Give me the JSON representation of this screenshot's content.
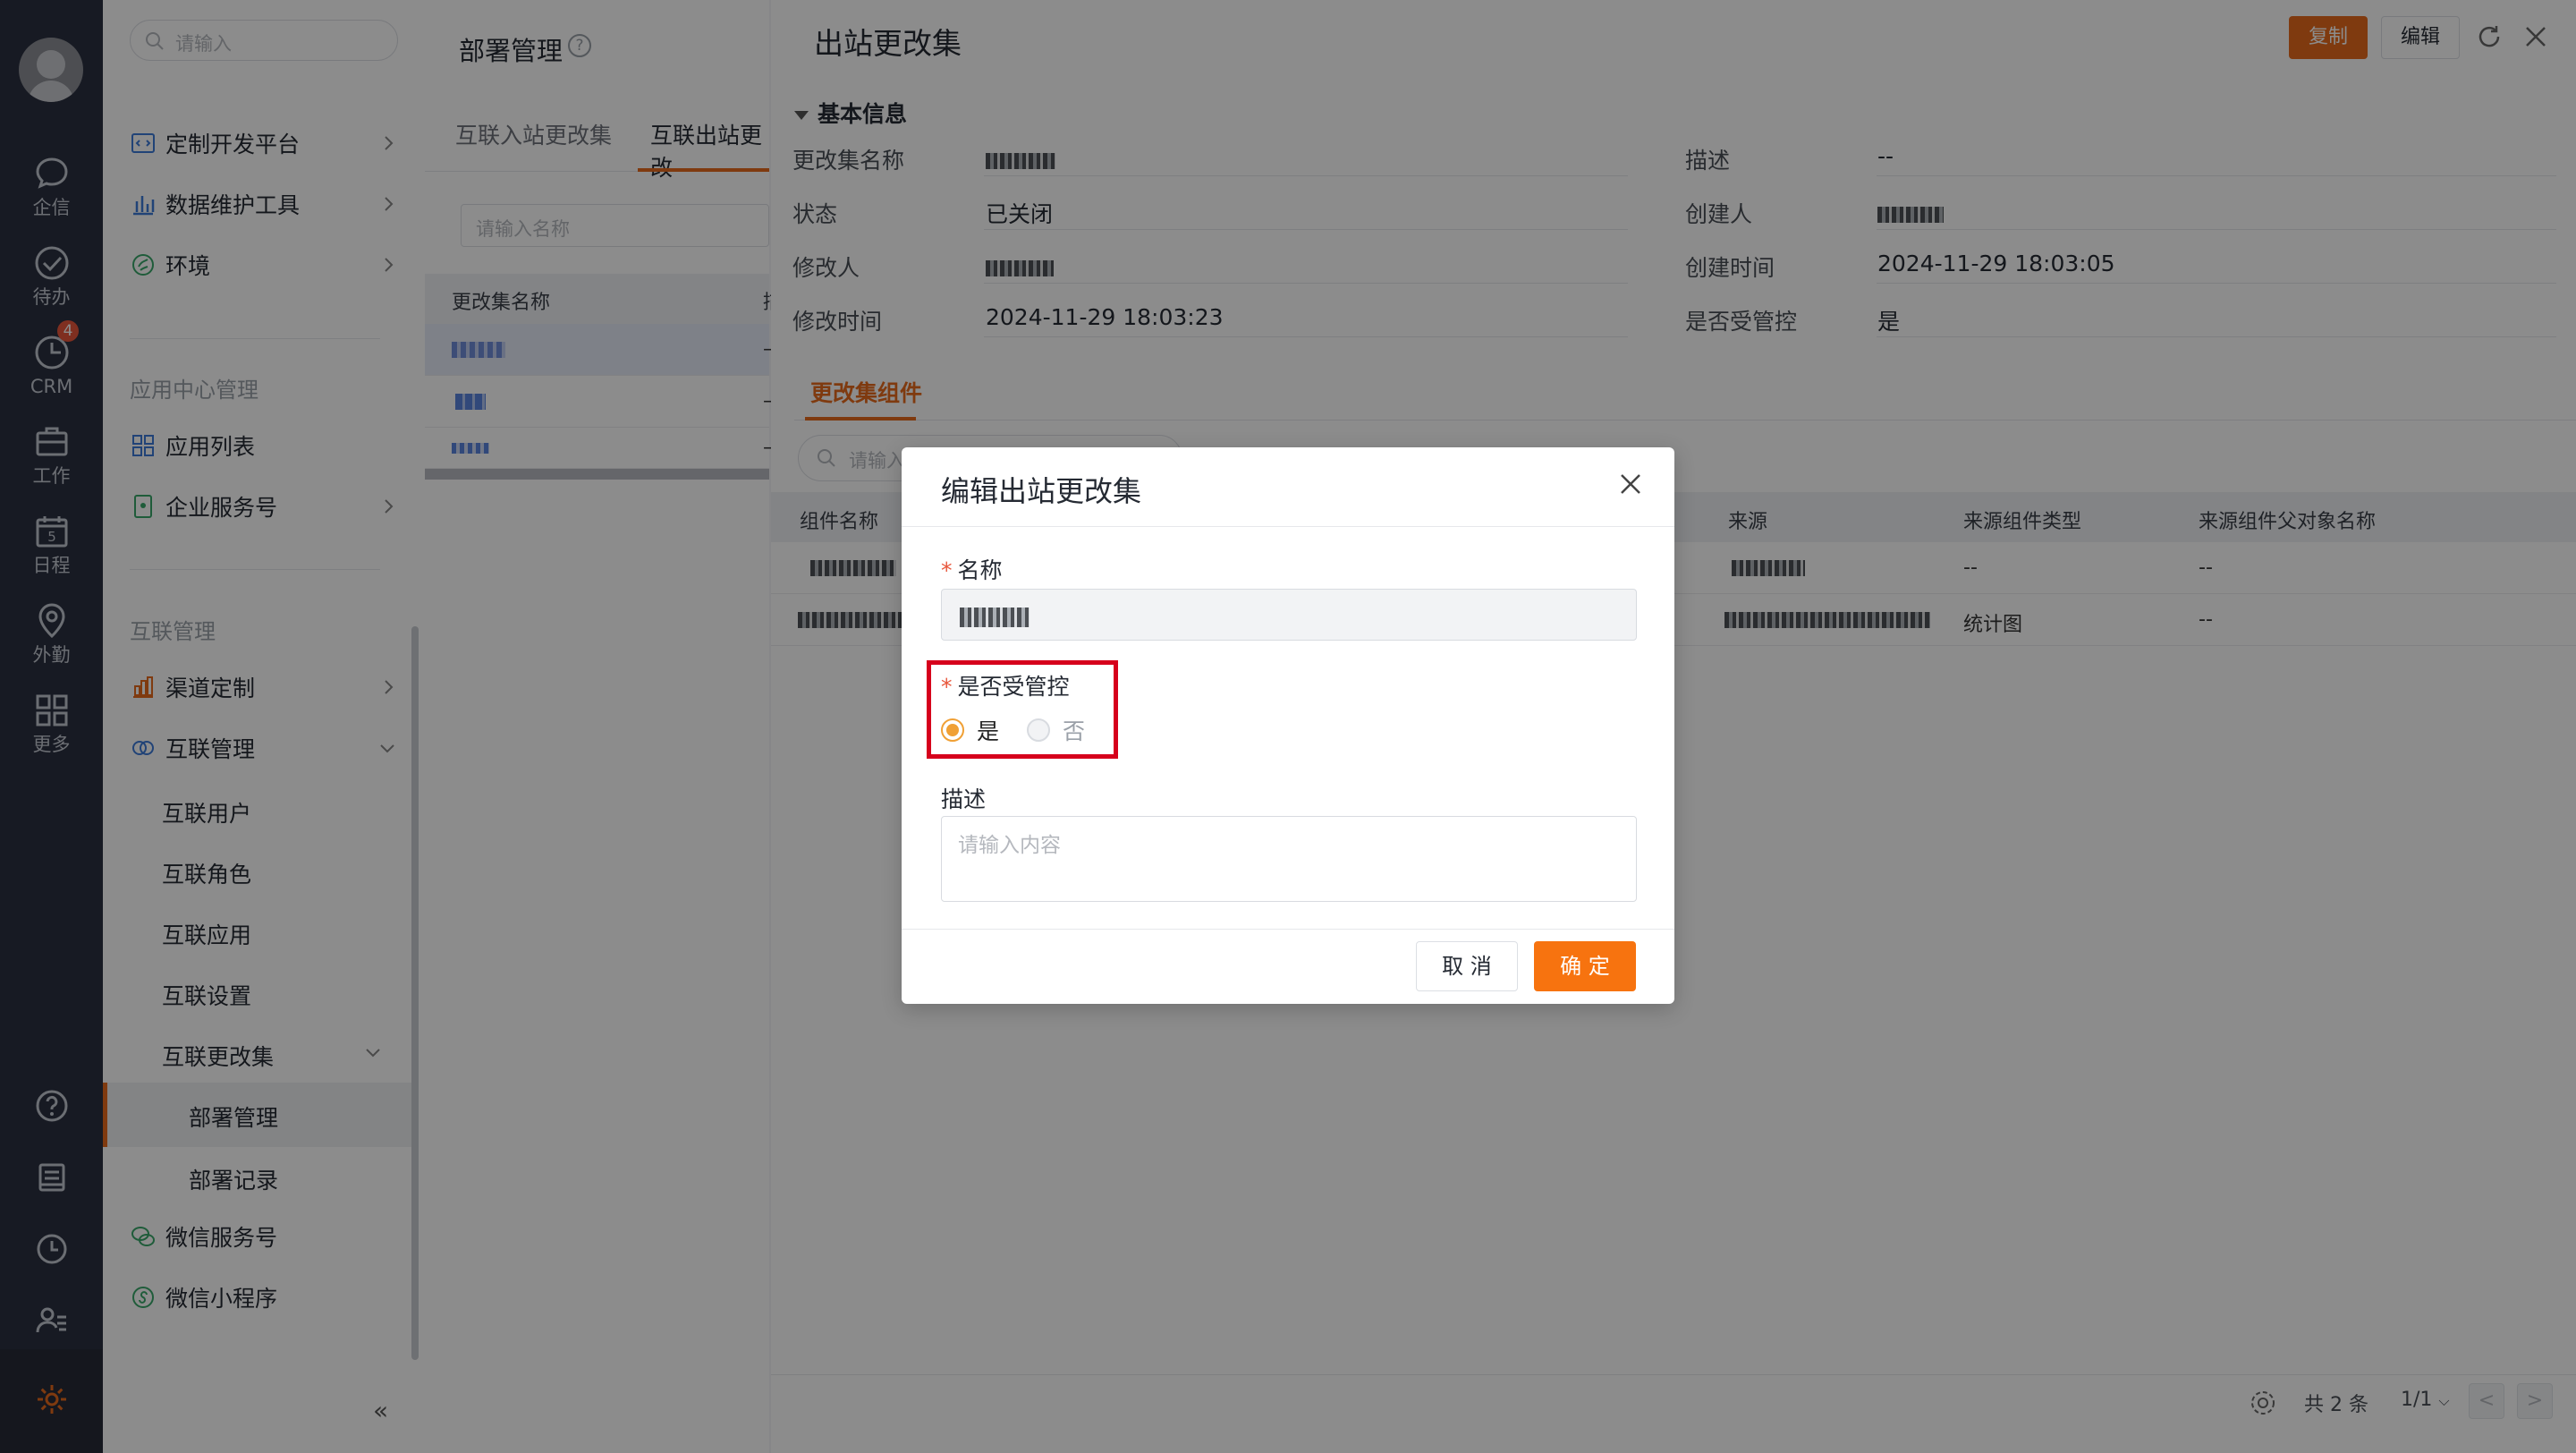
{
  "rail": {
    "items": [
      {
        "label": "企信",
        "icon": "chat-bubble-icon"
      },
      {
        "label": "待办",
        "icon": "check-circle-icon"
      },
      {
        "label": "CRM",
        "icon": "clock-pie-icon",
        "badge": "4"
      },
      {
        "label": "工作",
        "icon": "briefcase-icon"
      },
      {
        "label": "日程",
        "icon": "calendar-icon",
        "day": "5"
      },
      {
        "label": "外勤",
        "icon": "location-pin-icon"
      },
      {
        "label": "更多",
        "icon": "grid-icon"
      }
    ]
  },
  "sidebar": {
    "search_placeholder": "请输入",
    "items": [
      {
        "label": "定制开发平台"
      },
      {
        "label": "数据维护工具"
      },
      {
        "label": "环境"
      }
    ],
    "group_app_center": "应用中心管理",
    "app_items": [
      {
        "label": "应用列表"
      },
      {
        "label": "企业服务号"
      }
    ],
    "group_interconnect": "互联管理",
    "ic_items": [
      {
        "label": "渠道定制"
      },
      {
        "label": "互联管理"
      }
    ],
    "ic_subitems": [
      "互联用户",
      "互联角色",
      "互联应用",
      "互联设置",
      "互联更改集"
    ],
    "changeset_subitems": [
      "部署管理",
      "部署记录"
    ],
    "bottom_items": [
      {
        "label": "微信服务号"
      },
      {
        "label": "微信小程序"
      }
    ],
    "collapse_label": "«"
  },
  "middle": {
    "title": "部署管理",
    "help": "?",
    "tabs": [
      "互联入站更改集",
      "互联出站更改"
    ],
    "search_placeholder": "请输入名称",
    "columns": [
      "更改集名称",
      "描"
    ],
    "rows": [
      {
        "col2": "–"
      },
      {
        "col2": "–"
      },
      {
        "col2": "–"
      }
    ]
  },
  "detail": {
    "title": "出站更改集",
    "copy_label": "复制",
    "edit_label": "编辑",
    "section_title": "基本信息",
    "fields": {
      "name_label": "更改集名称",
      "status_label": "状态",
      "status_value": "已关闭",
      "modifier_label": "修改人",
      "modified_time_label": "修改时间",
      "modified_time_value": "2024-11-29 18:03:23",
      "desc_label": "描述",
      "desc_value": "--",
      "creator_label": "创建人",
      "created_time_label": "创建时间",
      "created_time_value": "2024-11-29 18:03:05",
      "controlled_label": "是否受管控",
      "controlled_value": "是"
    },
    "tab_components": "更改集组件",
    "search_placeholder": "请输入",
    "columns": [
      "组件名称",
      "来源",
      "来源组件类型",
      "来源组件父对象名称"
    ],
    "rows": [
      {
        "type": "--",
        "parent": "--"
      },
      {
        "type": "统计图",
        "parent": "--"
      }
    ],
    "footer": {
      "total": "共 2 条",
      "page": "1/1",
      "prev": "<",
      "next": ">"
    }
  },
  "modal": {
    "title": "编辑出站更改集",
    "name_label": "名称",
    "required_mark": "*",
    "controlled_label": "是否受管控",
    "option_yes": "是",
    "option_no": "否",
    "selected": "是",
    "desc_label": "描述",
    "desc_placeholder": "请输入内容",
    "cancel_label": "取 消",
    "ok_label": "确 定"
  },
  "colors": {
    "accent": "#e86b1c",
    "primary_button": "#f7730f",
    "highlight_border": "#d6001c",
    "rail_bg": "#2b3040"
  }
}
